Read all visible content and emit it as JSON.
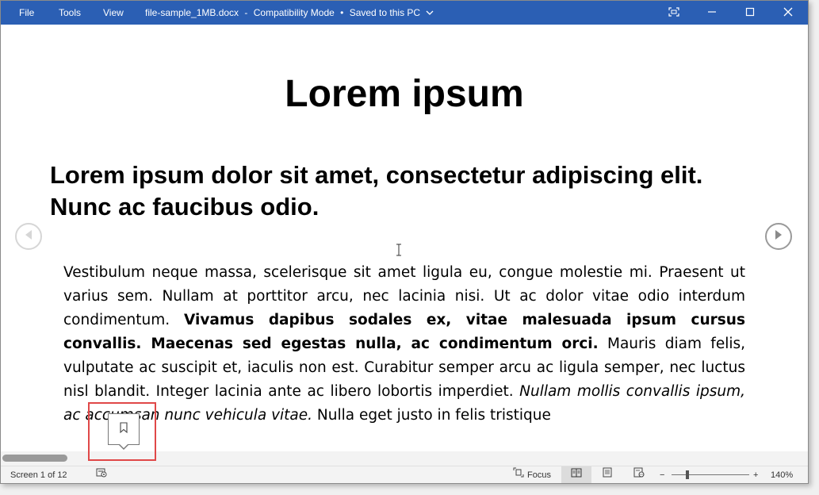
{
  "titlebar": {
    "menu": [
      "File",
      "Tools",
      "View"
    ],
    "filename": "file-sample_1MB.docx",
    "mode": "Compatibility Mode",
    "save_status": "Saved to this PC",
    "sep1": "-",
    "sep2": "•",
    "bg_color": "#2b5fb4"
  },
  "document": {
    "title": "Lorem ipsum",
    "subtitle": "Lorem ipsum dolor sit amet, consectetur adipiscing elit. Nunc ac faucibus odio.",
    "paragraph": {
      "normal1": "Vestibulum neque massa, scelerisque sit amet ligula eu, congue molestie mi. Praesent ut varius sem. Nullam at porttitor arcu, nec lacinia nisi. Ut ac dolor vitae odio interdum condimentum. ",
      "bold": "Vivamus dapibus sodales ex, vitae malesuada ipsum cursus convallis. Maecenas sed egestas nulla, ac condimentum orci.",
      "normal2": " Mauris diam felis, vulputate ac suscipit et, iaculis non est. Curabitur semper arcu ac ligula semper, nec luctus nisl blandit. Integer lacinia ante ac libero lobortis imperdiet. ",
      "italic": "Nullam mollis convallis ipsum, ac accumsan nunc vehicula vitae.",
      "normal3": " Nulla eget justo in felis tristique"
    }
  },
  "statusbar": {
    "page_info": "Screen 1 of 12",
    "focus_label": "Focus",
    "zoom_level": "140%",
    "zoom_minus": "−",
    "zoom_plus": "+",
    "zoom_fraction": 0.2
  },
  "icons": {
    "prev_page": "chevron-left-circle-icon",
    "next_page": "chevron-right-circle-icon",
    "bookmark": "bookmark-icon",
    "focus": "focus-icon",
    "read_mode": "read-mode-icon",
    "print_layout": "print-layout-icon",
    "web_layout": "web-layout-icon",
    "accessibility": "accessibility-icon"
  },
  "colors": {
    "highlight_box": "#e04848"
  }
}
